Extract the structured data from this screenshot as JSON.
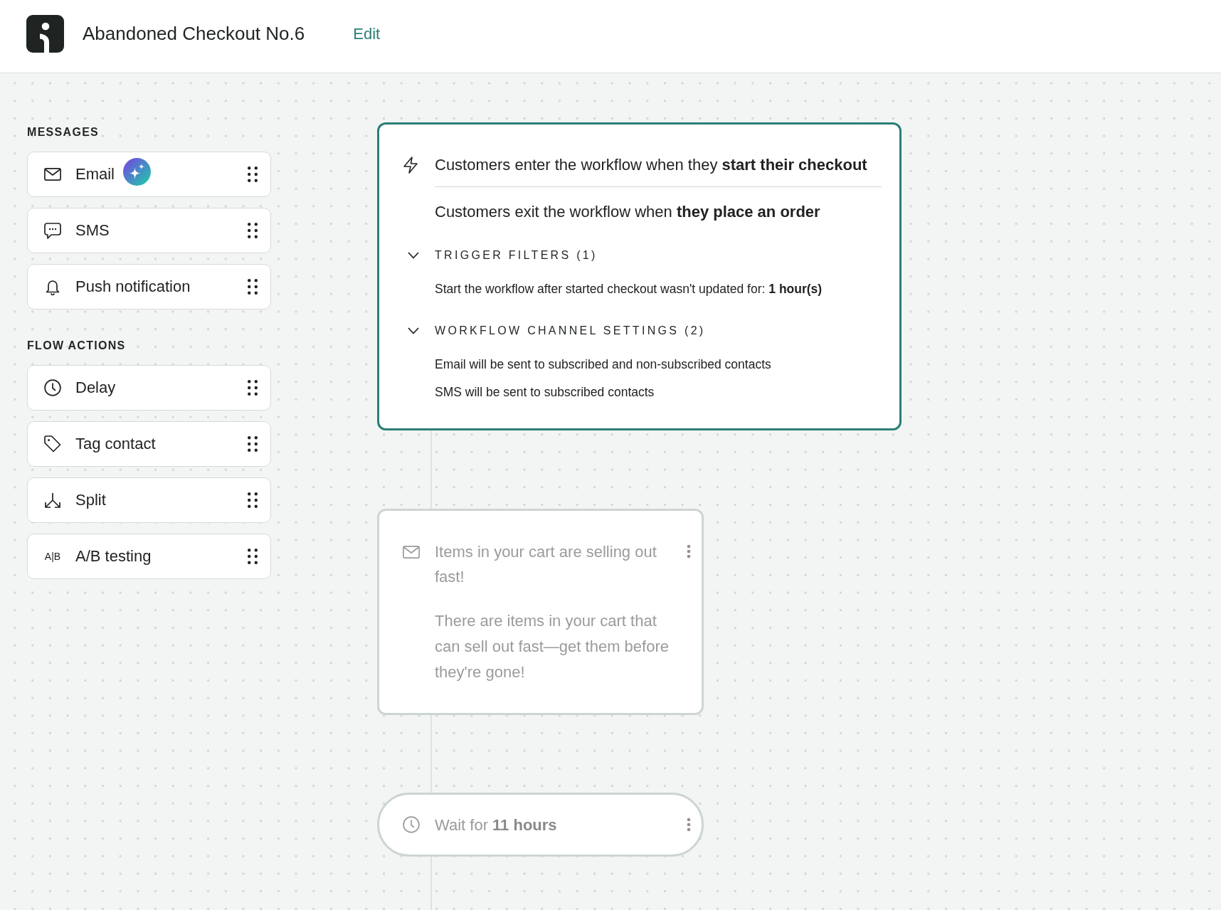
{
  "header": {
    "title": "Abandoned Checkout No.6",
    "edit_link": "Edit"
  },
  "sidebar": {
    "groups": [
      {
        "heading": "MESSAGES",
        "items": [
          {
            "label": "Email"
          },
          {
            "label": "SMS"
          },
          {
            "label": "Push notification"
          }
        ]
      },
      {
        "heading": "FLOW ACTIONS",
        "items": [
          {
            "label": "Delay"
          },
          {
            "label": "Tag contact"
          },
          {
            "label": "Split"
          },
          {
            "label": "A/B testing",
            "icon_text": "A|B"
          }
        ]
      }
    ]
  },
  "workflow": {
    "trigger": {
      "entry": "Customers enter the workflow when they **start their checkout**",
      "exit": "Customers exit the workflow when **they place an order**",
      "sections": [
        {
          "heading": "TRIGGER FILTERS (1)",
          "expanded": true,
          "lines": [
            "Start the workflow after started checkout wasn't updated for: **1 hour(s)**"
          ]
        },
        {
          "heading": "WORKFLOW CHANNEL SETTINGS (2)",
          "expanded": true,
          "lines": [
            "Email will be sent to subscribed and non-subscribed contacts",
            "SMS will be sent to subscribed contacts"
          ]
        }
      ]
    },
    "nodes": [
      {
        "kind": "email",
        "subject": "Items in your cart are selling out fast!",
        "preview": "There are items in your cart that can sell out fast—get them before they're gone!"
      },
      {
        "kind": "wait",
        "text": "Wait for **11 hours**"
      }
    ]
  }
}
